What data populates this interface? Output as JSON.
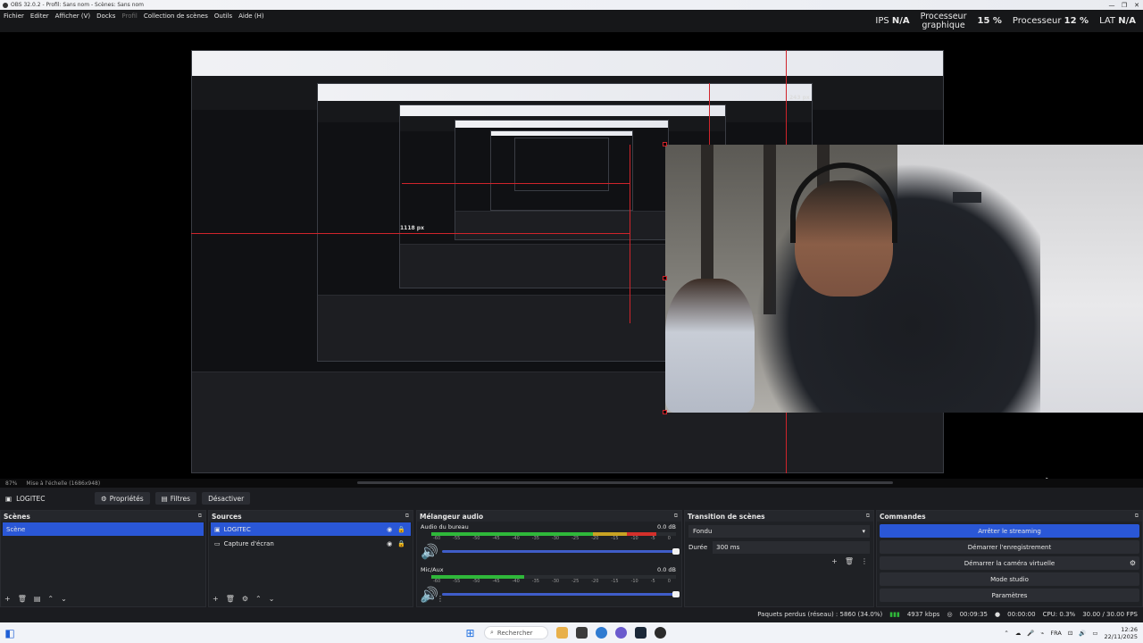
{
  "window": {
    "title": "OBS 32.0.2 - Profil: Sans nom - Scènes: Sans nom",
    "controls": [
      "—",
      "❐",
      "✕"
    ]
  },
  "menu": [
    {
      "label": "Fichier"
    },
    {
      "label": "Editer"
    },
    {
      "label": "Afficher (V)"
    },
    {
      "label": "Docks"
    },
    {
      "label": "Profil"
    },
    {
      "label": "Collection de scènes"
    },
    {
      "label": "Outils"
    },
    {
      "label": "Aide (H)"
    }
  ],
  "stats": {
    "fps_label": "IPS",
    "fps_value": "N/A",
    "gpu_label_line1": "Processeur",
    "gpu_label_line2": "graphique",
    "gpu_value": "15 %",
    "cpu_label": "Processeur",
    "cpu_value": "12 %",
    "lat_label": "LAT",
    "lat_value": "N/A"
  },
  "preview": {
    "inner_measure_1": "1118 px",
    "inner_measure_2": "243 px",
    "zoom": "87%",
    "scale_label": "Mise à l'échelle (1686x948)"
  },
  "context_bar": {
    "source_name": "LOGITEC",
    "properties_label": "Propriétés",
    "filters_label": "Filtres",
    "deactivate_label": "Désactiver"
  },
  "scenes": {
    "title": "Scènes",
    "items": [
      "Scène"
    ]
  },
  "sources": {
    "title": "Sources",
    "items": [
      "LOGITEC",
      "Capture d'écran"
    ]
  },
  "mixer": {
    "title": "Mélangeur audio",
    "ticks": [
      "-60",
      "-55",
      "-50",
      "-45",
      "-40",
      "-35",
      "-30",
      "-25",
      "-20",
      "-15",
      "-10",
      "-5",
      "0"
    ],
    "channels": [
      {
        "name": "Audio du bureau",
        "db": "0.0 dB",
        "green": 0.66,
        "yellow": 0.14,
        "red": 0.12
      },
      {
        "name": "Mic/Aux",
        "db": "0.0 dB",
        "green": 0.38,
        "yellow": 0.0,
        "red": 0.0
      }
    ]
  },
  "transitions": {
    "title": "Transition de scènes",
    "selected": "Fondu",
    "duration_label": "Durée",
    "duration_value": "300 ms"
  },
  "controls": {
    "title": "Commandes",
    "buttons": [
      "Arrêter le streaming",
      "Démarrer l'enregistrement",
      "Démarrer la caméra virtuelle",
      "Mode studio",
      "Paramètres"
    ]
  },
  "statusbar": {
    "dropped": "Paquets perdus (réseau) : 5860 (34.0%)",
    "bitrate": "4937 kbps",
    "stream_time": "00:09:35",
    "rec_time": "00:00:00",
    "cpu": "CPU: 0.3%",
    "fps": "30.00 / 30.00 FPS"
  },
  "taskbar": {
    "search_placeholder": "Rechercher",
    "lang": "FRA",
    "time": "12:26",
    "date": "22/11/2025"
  },
  "colors": {
    "accent": "#2a57d6",
    "meter_green": "#2fb83a",
    "meter_yellow": "#c9a323",
    "meter_red": "#d4302b",
    "selection_red": "#d0242b"
  }
}
